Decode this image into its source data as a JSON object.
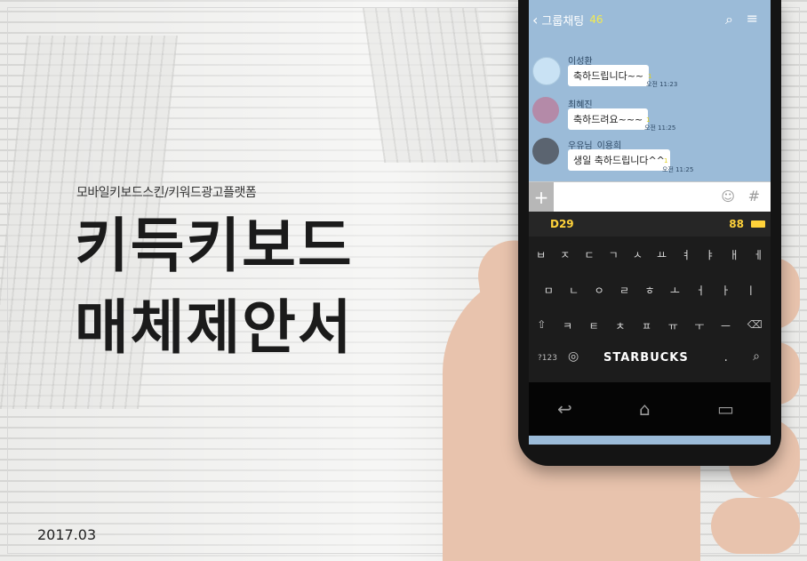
{
  "subtitle": "모바일키보드스킨/키워드광고플랫폼",
  "title_line1": "키득키보드",
  "title_line2": "매체제안서",
  "date": "2017.03",
  "phone": {
    "chat_title": "그룹채팅",
    "member_count": "46",
    "back_icon": "‹",
    "messages": [
      {
        "sender": "이성환",
        "text": "축하드립니다~~",
        "unread": "1",
        "time": "오전 11:23"
      },
      {
        "sender": "최혜진",
        "text": "축하드려요~~~",
        "unread": "1",
        "time": "오전 11:25"
      },
      {
        "sender": "우유님_이용희",
        "text": "생일 축하드립니다^^",
        "unread": "1",
        "time": "오전 11:25"
      }
    ],
    "input": {
      "plus": "+",
      "emoji_icon": "☺",
      "hash": "#"
    },
    "keyboard": {
      "left_badge": "D29",
      "right_badge": "88",
      "row1": [
        "ㅂ",
        "ㅈ",
        "ㄷ",
        "ㄱ",
        "ㅅ",
        "ㅛ",
        "ㅕ",
        "ㅑ",
        "ㅐ",
        "ㅔ"
      ],
      "row2": [
        "ㅁ",
        "ㄴ",
        "ㅇ",
        "ㄹ",
        "ㅎ",
        "ㅗ",
        "ㅓ",
        "ㅏ",
        "ㅣ"
      ],
      "row3": [
        "⇧",
        "ㅋ",
        "ㅌ",
        "ㅊ",
        "ㅍ",
        "ㅠ",
        "ㅜ",
        "ㅡ",
        "⌫"
      ],
      "key_7123": "?123",
      "brand": "STARBUCKS",
      "period": ".",
      "search_icon": "⌕"
    },
    "nav": {
      "back": "↩",
      "home": "⌂",
      "recent": "▭"
    }
  },
  "colors": {
    "chat_bg": "#9bbbd8",
    "accent_yellow": "#ffd23a",
    "title_text": "#1b1b1b"
  }
}
